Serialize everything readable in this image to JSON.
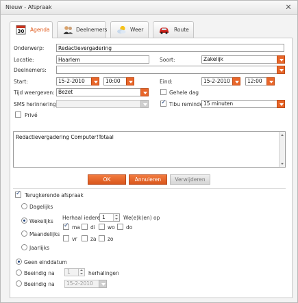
{
  "window": {
    "title": "Nieuw - Afspraak",
    "close_glyph": "✕"
  },
  "tabs": [
    {
      "label": "Agenda",
      "icon": "calendar-icon",
      "calendar_day": "30"
    },
    {
      "label": "Deelnemers",
      "icon": "people-icon"
    },
    {
      "label": "Weer",
      "icon": "weather-icon"
    },
    {
      "label": "Route",
      "icon": "car-icon"
    }
  ],
  "form": {
    "onderwerp_label": "Onderwerp:",
    "onderwerp_value": "Redactievergadering",
    "locatie_label": "Locatie:",
    "locatie_value": "Haarlem",
    "soort_label": "Soort:",
    "soort_value": "Zakelijk",
    "deelnemers_label": "Deelnemers:",
    "deelnemers_value": "",
    "start_label": "Start:",
    "start_date": "15-2-2010",
    "start_time": "10:00",
    "eind_label": "Eind:",
    "eind_date": "15-2-2010",
    "eind_time": "12:00",
    "tijd_label": "Tijd weergeven:",
    "tijd_value": "Bezet",
    "gehele_dag_label": "Gehele dag",
    "gehele_dag_checked": false,
    "sms_label": "SMS herinnering:",
    "sms_value": "",
    "tibu_label": "Tibu reminder",
    "tibu_checked": true,
    "tibu_value": "15 minuten",
    "prive_label": "Privé",
    "prive_checked": false,
    "notes_value": "Redactievergadering Computer!Totaal"
  },
  "buttons": {
    "ok": "OK",
    "cancel": "Annuleren",
    "delete": "Verwijderen"
  },
  "recurrence": {
    "label": "Terugkerende afspraak",
    "checked": true,
    "options": [
      "Dagelijks",
      "Wekelijks",
      "Maandelijks",
      "Jaarlijks"
    ],
    "selected": "Wekelijks",
    "repeat_prefix": "Herhaal iedere",
    "repeat_value": "1",
    "repeat_suffix": "We(e)k(en) op",
    "days": [
      {
        "label": "ma",
        "checked": true
      },
      {
        "label": "di",
        "checked": false
      },
      {
        "label": "wo",
        "checked": false
      },
      {
        "label": "do",
        "checked": false
      },
      {
        "label": "vr",
        "checked": false
      },
      {
        "label": "za",
        "checked": false
      },
      {
        "label": "zo",
        "checked": false
      }
    ]
  },
  "end": {
    "options": [
      "Geen einddatum",
      "Beeindig na",
      "Beeindig na"
    ],
    "selected": "Geen einddatum",
    "count_value": "1",
    "count_suffix": "herhalingen",
    "date_value": "15-2-2010"
  },
  "colors": {
    "accent": "#e8662a",
    "check": "#1a3e7a"
  }
}
